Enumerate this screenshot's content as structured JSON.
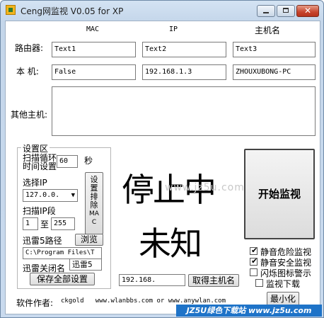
{
  "window": {
    "title": "Ceng网监视 V0.05 for XP",
    "close_glyph": "✕"
  },
  "columns": {
    "mac": "MAC",
    "ip": "IP",
    "hostname": "主机名"
  },
  "rows": {
    "router_label": "路由器:",
    "router_mac": "Text1",
    "router_ip": "Text2",
    "router_host": "Text3",
    "local_label": "本  机:",
    "local_mac": "False",
    "local_ip": "192.168.1.3",
    "local_host": "ZHOUXUBONG-PC",
    "other_label": "其他主机:"
  },
  "settings": {
    "group_title": "设置区",
    "scan_interval_label_1": "扫描循环",
    "scan_interval_label_2": "时间设置",
    "scan_interval_value": "60",
    "seconds_label": "秒",
    "select_ip_label": "选择IP",
    "select_ip_value": "127.0.0.",
    "scan_range_label": "扫描IP段",
    "range_start": "1",
    "range_to": "至",
    "range_end": "255",
    "exclude_mac_button": [
      "设",
      "置",
      "排",
      "除",
      "MA",
      "C"
    ],
    "xunlei_path_label": "迅雷5路径",
    "browse_button": "浏览",
    "xunlei_path_value": "C:\\Program Files\\T",
    "xunlei_close_label": "迅雷关闭名",
    "xunlei_close_value": "迅雷5",
    "save_all_button": "保存全部设置"
  },
  "status_display": {
    "line1": "停止中",
    "line2": "未知"
  },
  "watermark": "www.jz5u.com",
  "start_button": "开始监视",
  "checkboxes": [
    {
      "label": "静音危险监视",
      "checked": true
    },
    {
      "label": "静音安全监视",
      "checked": true
    },
    {
      "label": "闪烁图标警示",
      "checked": false
    },
    {
      "label": "监视下载",
      "checked": false
    }
  ],
  "hostname_lookup": {
    "ip_value": "192.168.",
    "button": "取得主机名"
  },
  "minimize_button": "最小化",
  "footer": {
    "author_label": "软件作者:",
    "author_value": "ckgold   www.wlanbbs.com or www.anywlan.com"
  },
  "status_bar": {
    "badge_text": "JZ5U绿色下载站 www.jz5u.com"
  },
  "colors": {
    "title_bar": "#c4d6ea",
    "close_button": "#c7452d",
    "status_badge": "#1e73c8"
  }
}
